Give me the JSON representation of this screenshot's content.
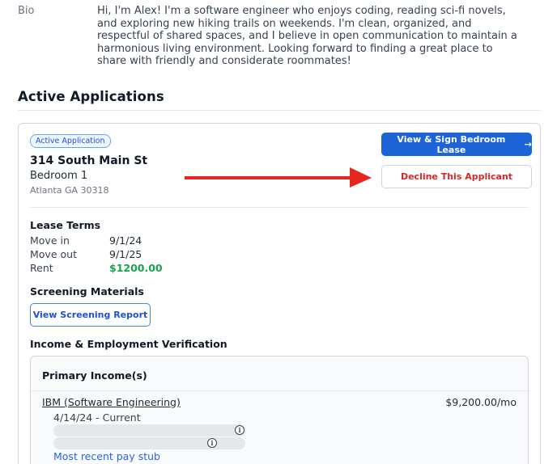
{
  "profile": {
    "bio_label": "Bio",
    "bio_text": "Hi, I'm Alex! I'm a software engineer who enjoys coding, reading sci-fi novels, and exploring new hiking trails on weekends. I'm clean, organized, and respectful of shared spaces, and I believe in open communication to maintain a harmonious living environment. Looking forward to finding a great place to share with friendly and considerate roommates!"
  },
  "applications": {
    "section_title": "Active Applications",
    "card": {
      "badge": "Active Application",
      "address": "314 South Main St",
      "bedroom": "Bedroom 1",
      "city": "Atlanta GA 30318",
      "sign_lease_label": "View & Sign Bedroom Lease",
      "sign_lease_arrow": "→",
      "decline_label": "Decline This Applicant",
      "lease_terms": {
        "title": "Lease Terms",
        "move_in_label": "Move in",
        "move_in_value": "9/1/24",
        "move_out_label": "Move out",
        "move_out_value": "9/1/25",
        "rent_label": "Rent",
        "rent_value": "$1200.00"
      },
      "screening": {
        "title": "Screening Materials",
        "button_label": "View Screening Report"
      },
      "income": {
        "title": "Income & Employment Verification",
        "primary_title": "Primary Income(s)",
        "employer": "IBM (Software Engineering)",
        "amount": "$9,200.00/mo",
        "dates": "4/14/24 - Current",
        "info_glyph": "i",
        "pay_stub_link": "Most recent pay stub"
      }
    }
  },
  "colors": {
    "primary": "#1d64d8",
    "danger": "#dc2626",
    "success": "#16a34a",
    "annotation_arrow": "#e5261f"
  },
  "icons": {
    "annotation": "red-arrow-right-icon",
    "info": "info-circle-icon"
  }
}
